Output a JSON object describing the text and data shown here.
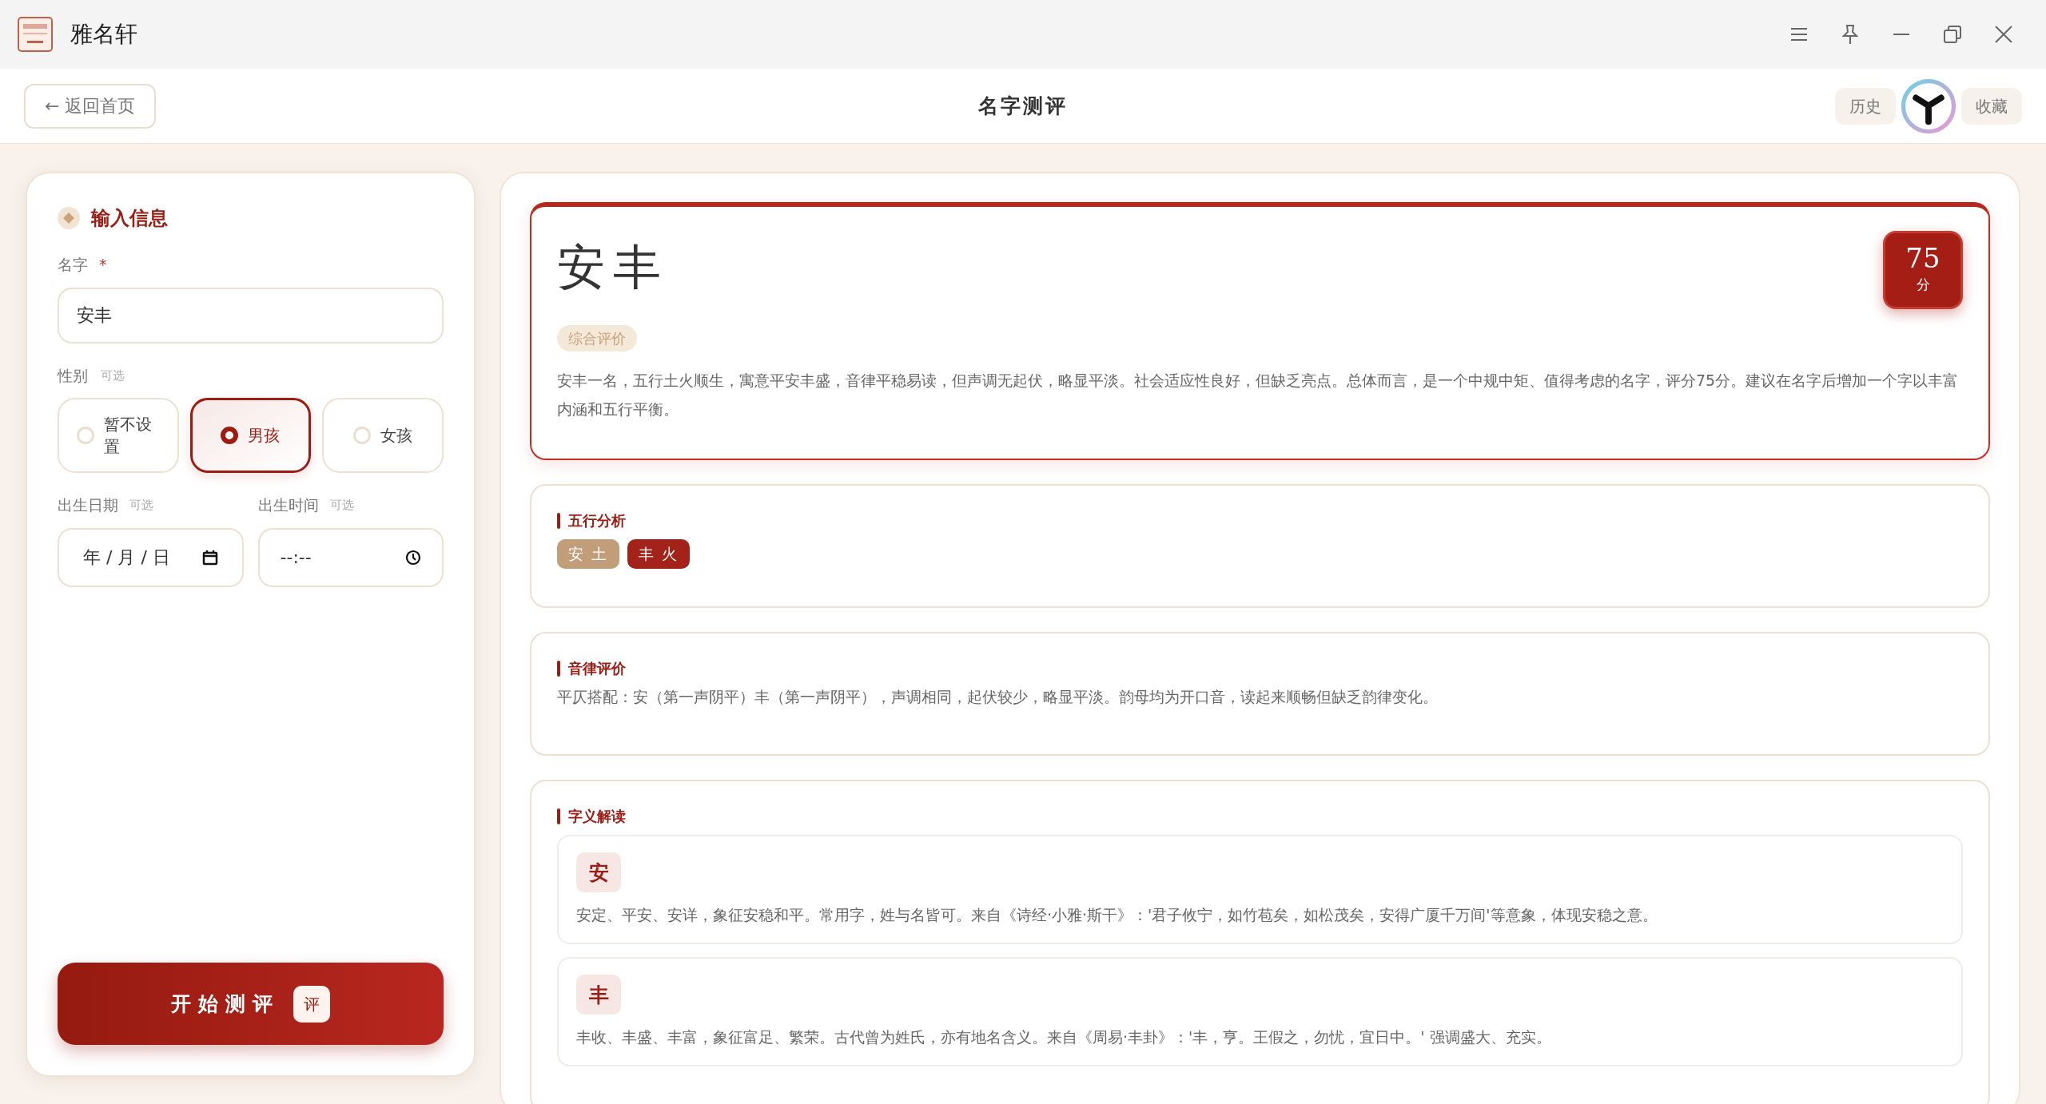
{
  "window": {
    "title": "雅名轩"
  },
  "header": {
    "back": "← 返回首页",
    "title": "名字测评",
    "actions": [
      "历史",
      "收藏"
    ]
  },
  "form": {
    "heading": "输入信息",
    "name_label": "名字",
    "required_mark": "*",
    "name_value": "安丰",
    "gender_label": "性别",
    "gender_hint": "可选",
    "genders": [
      {
        "label": "暂不设置",
        "selected": false
      },
      {
        "label": "男孩",
        "selected": true
      },
      {
        "label": "女孩",
        "selected": false
      }
    ],
    "date_label": "出生日期",
    "date_hint": "可选",
    "date_value": "年 / 月 / 日",
    "time_label": "出生时间",
    "time_hint": "可选",
    "time_value": "--:--",
    "submit": "开 始 测 评",
    "submit_badge": "评"
  },
  "result": {
    "name": "安丰",
    "score": "75",
    "score_unit": "分",
    "summary_tag": "综合评价",
    "summary": "安丰一名，五行土火顺生，寓意平安丰盛，音律平稳易读，但声调无起伏，略显平淡。社会适应性良好，但缺乏亮点。总体而言，是一个中规中矩、值得考虑的名字，评分75分。建议在名字后增加一个字以丰富内涵和五行平衡。",
    "five_elements_title": "五行分析",
    "elements": [
      {
        "label": "安 土",
        "color": "#c19e79"
      },
      {
        "label": "丰 火",
        "color": "#a3231b"
      }
    ],
    "rhythm_title": "音律评价",
    "rhythm": "平仄搭配：安（第一声阴平）丰（第一声阴平），声调相同，起伏较少，略显平淡。韵母均为开口音，读起来顺畅但缺乏韵律变化。",
    "meaning_title": "字义解读",
    "chars": [
      {
        "char": "安",
        "text": "安定、平安、安详，象征安稳和平。常用字，姓与名皆可。来自《诗经·小雅·斯干》：'君子攸宁，如竹苞矣，如松茂矣，安得广厦千万间'等意象，体现安稳之意。"
      },
      {
        "char": "丰",
        "text": "丰收、丰盛、丰富，象征富足、繁荣。古代曾为姓氏，亦有地名含义。来自《周易·丰卦》：'丰，亨。王假之，勿忧，宜日中。' 强调盛大、充实。"
      }
    ]
  }
}
